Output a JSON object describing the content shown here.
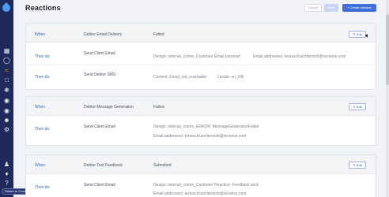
{
  "page": {
    "title": "Reactions"
  },
  "toolbar": {
    "cancel_label": "Cancel",
    "save_label": "Save",
    "create_label": "+ Create reaction"
  },
  "sidebar": {
    "tooltip": "Switch to Customer",
    "icons": [
      "logo-icon",
      "dashboard-icon",
      "globe-icon",
      "activity-icon",
      "files-icon",
      "network-icon",
      "group-icon",
      "location-icon",
      "group-icon",
      "settings-icon",
      "user-icon",
      "bell-icon",
      "help-icon",
      "customer-icon"
    ]
  },
  "cards": [
    {
      "when_label": "When",
      "trigger": "Debtor Email Delivery",
      "status": "Failed",
      "edit_label": "✎ Edit",
      "actions": [
        {
          "then_label": "Then do",
          "action": "Send Client Email",
          "line1": "Design: internal_comm_Customer Email bounced",
          "line1b": "Email addresses: teresa.fruechtenicht@receeve.com"
        },
        {
          "then_label": "Then do",
          "action": "Send Debtor SMS",
          "line1": "Content: Email_not_reachable",
          "line1b": "Locale: en_GB"
        }
      ]
    },
    {
      "when_label": "When",
      "trigger": "Debtor Message Generation",
      "status": "Failed",
      "edit_label": "✎ Edit",
      "actions": [
        {
          "then_label": "Then do",
          "action": "Send Client Email",
          "line1": "Design: internal_comm_ERROR: MessageGenerationFailed",
          "line2": "Email addresses: teresa.fruechtenicht@receeve.com"
        }
      ]
    },
    {
      "when_label": "When",
      "trigger": "Debtor Text Feedback",
      "status": "Submitted",
      "edit_label": "✎ Edit",
      "actions": [
        {
          "then_label": "Then do",
          "action": "Send Client Email",
          "line1": "Design: internal_comm_Customer Reaction: Feedback sent",
          "line2": "Email addresses: teresa.fruechtenicht@receeve.com"
        }
      ]
    }
  ]
}
